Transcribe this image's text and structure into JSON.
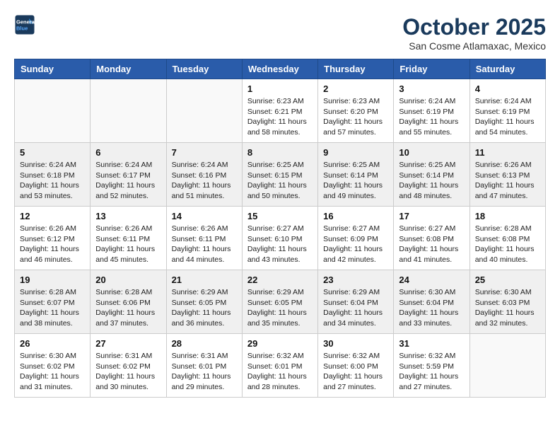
{
  "header": {
    "logo_line1": "General",
    "logo_line2": "Blue",
    "month_title": "October 2025",
    "location": "San Cosme Atlamaxac, Mexico"
  },
  "weekdays": [
    "Sunday",
    "Monday",
    "Tuesday",
    "Wednesday",
    "Thursday",
    "Friday",
    "Saturday"
  ],
  "weeks": [
    [
      {
        "day": "",
        "info": ""
      },
      {
        "day": "",
        "info": ""
      },
      {
        "day": "",
        "info": ""
      },
      {
        "day": "1",
        "info": "Sunrise: 6:23 AM\nSunset: 6:21 PM\nDaylight: 11 hours\nand 58 minutes."
      },
      {
        "day": "2",
        "info": "Sunrise: 6:23 AM\nSunset: 6:20 PM\nDaylight: 11 hours\nand 57 minutes."
      },
      {
        "day": "3",
        "info": "Sunrise: 6:24 AM\nSunset: 6:19 PM\nDaylight: 11 hours\nand 55 minutes."
      },
      {
        "day": "4",
        "info": "Sunrise: 6:24 AM\nSunset: 6:19 PM\nDaylight: 11 hours\nand 54 minutes."
      }
    ],
    [
      {
        "day": "5",
        "info": "Sunrise: 6:24 AM\nSunset: 6:18 PM\nDaylight: 11 hours\nand 53 minutes."
      },
      {
        "day": "6",
        "info": "Sunrise: 6:24 AM\nSunset: 6:17 PM\nDaylight: 11 hours\nand 52 minutes."
      },
      {
        "day": "7",
        "info": "Sunrise: 6:24 AM\nSunset: 6:16 PM\nDaylight: 11 hours\nand 51 minutes."
      },
      {
        "day": "8",
        "info": "Sunrise: 6:25 AM\nSunset: 6:15 PM\nDaylight: 11 hours\nand 50 minutes."
      },
      {
        "day": "9",
        "info": "Sunrise: 6:25 AM\nSunset: 6:14 PM\nDaylight: 11 hours\nand 49 minutes."
      },
      {
        "day": "10",
        "info": "Sunrise: 6:25 AM\nSunset: 6:14 PM\nDaylight: 11 hours\nand 48 minutes."
      },
      {
        "day": "11",
        "info": "Sunrise: 6:26 AM\nSunset: 6:13 PM\nDaylight: 11 hours\nand 47 minutes."
      }
    ],
    [
      {
        "day": "12",
        "info": "Sunrise: 6:26 AM\nSunset: 6:12 PM\nDaylight: 11 hours\nand 46 minutes."
      },
      {
        "day": "13",
        "info": "Sunrise: 6:26 AM\nSunset: 6:11 PM\nDaylight: 11 hours\nand 45 minutes."
      },
      {
        "day": "14",
        "info": "Sunrise: 6:26 AM\nSunset: 6:11 PM\nDaylight: 11 hours\nand 44 minutes."
      },
      {
        "day": "15",
        "info": "Sunrise: 6:27 AM\nSunset: 6:10 PM\nDaylight: 11 hours\nand 43 minutes."
      },
      {
        "day": "16",
        "info": "Sunrise: 6:27 AM\nSunset: 6:09 PM\nDaylight: 11 hours\nand 42 minutes."
      },
      {
        "day": "17",
        "info": "Sunrise: 6:27 AM\nSunset: 6:08 PM\nDaylight: 11 hours\nand 41 minutes."
      },
      {
        "day": "18",
        "info": "Sunrise: 6:28 AM\nSunset: 6:08 PM\nDaylight: 11 hours\nand 40 minutes."
      }
    ],
    [
      {
        "day": "19",
        "info": "Sunrise: 6:28 AM\nSunset: 6:07 PM\nDaylight: 11 hours\nand 38 minutes."
      },
      {
        "day": "20",
        "info": "Sunrise: 6:28 AM\nSunset: 6:06 PM\nDaylight: 11 hours\nand 37 minutes."
      },
      {
        "day": "21",
        "info": "Sunrise: 6:29 AM\nSunset: 6:05 PM\nDaylight: 11 hours\nand 36 minutes."
      },
      {
        "day": "22",
        "info": "Sunrise: 6:29 AM\nSunset: 6:05 PM\nDaylight: 11 hours\nand 35 minutes."
      },
      {
        "day": "23",
        "info": "Sunrise: 6:29 AM\nSunset: 6:04 PM\nDaylight: 11 hours\nand 34 minutes."
      },
      {
        "day": "24",
        "info": "Sunrise: 6:30 AM\nSunset: 6:04 PM\nDaylight: 11 hours\nand 33 minutes."
      },
      {
        "day": "25",
        "info": "Sunrise: 6:30 AM\nSunset: 6:03 PM\nDaylight: 11 hours\nand 32 minutes."
      }
    ],
    [
      {
        "day": "26",
        "info": "Sunrise: 6:30 AM\nSunset: 6:02 PM\nDaylight: 11 hours\nand 31 minutes."
      },
      {
        "day": "27",
        "info": "Sunrise: 6:31 AM\nSunset: 6:02 PM\nDaylight: 11 hours\nand 30 minutes."
      },
      {
        "day": "28",
        "info": "Sunrise: 6:31 AM\nSunset: 6:01 PM\nDaylight: 11 hours\nand 29 minutes."
      },
      {
        "day": "29",
        "info": "Sunrise: 6:32 AM\nSunset: 6:01 PM\nDaylight: 11 hours\nand 28 minutes."
      },
      {
        "day": "30",
        "info": "Sunrise: 6:32 AM\nSunset: 6:00 PM\nDaylight: 11 hours\nand 27 minutes."
      },
      {
        "day": "31",
        "info": "Sunrise: 6:32 AM\nSunset: 5:59 PM\nDaylight: 11 hours\nand 27 minutes."
      },
      {
        "day": "",
        "info": ""
      }
    ]
  ]
}
